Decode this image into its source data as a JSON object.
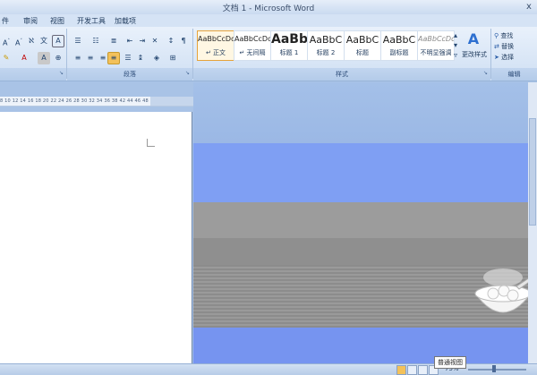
{
  "title_bar": {
    "title": "文档 1 - Microsoft Word",
    "close_glyph": "x"
  },
  "tabs": [
    "件",
    "审阅",
    "视图",
    "开发工具",
    "加载项"
  ],
  "ribbon": {
    "groups": {
      "paragraph": "段落",
      "styles": "样式",
      "editing": "编辑"
    },
    "styles": [
      {
        "sample": "AaBbCcDd",
        "name": "↵ 正文",
        "selected": true
      },
      {
        "sample": "AaBbCcDd",
        "name": "↵ 无间隔",
        "selected": false
      },
      {
        "sample": "AaBb",
        "name": "标题 1",
        "selected": false
      },
      {
        "sample": "AaBbC",
        "name": "标题 2",
        "selected": false
      },
      {
        "sample": "AaBbC",
        "name": "标题",
        "selected": false
      },
      {
        "sample": "AaBbC",
        "name": "副标题",
        "selected": false
      },
      {
        "sample": "AaBbCcDd",
        "name": "不明显强调",
        "selected": false
      }
    ],
    "change_styles_label": "更改样式",
    "editing": {
      "find": "查找",
      "replace": "替换",
      "select": "选择"
    }
  },
  "ruler_numbers": "8  10  12  14  16  18  20  22  24  26  28  30  32  34  36  38     42  44  46  48",
  "status_bar": {
    "zoom": "75%",
    "tooltip": "普通视图"
  },
  "background_colors": {
    "sky": "#9fbce6",
    "blue_band": "#7f9ff3",
    "gray": "#999999",
    "gray_dark": "#8a8a8a",
    "blue_bottom": "#7694f0"
  }
}
